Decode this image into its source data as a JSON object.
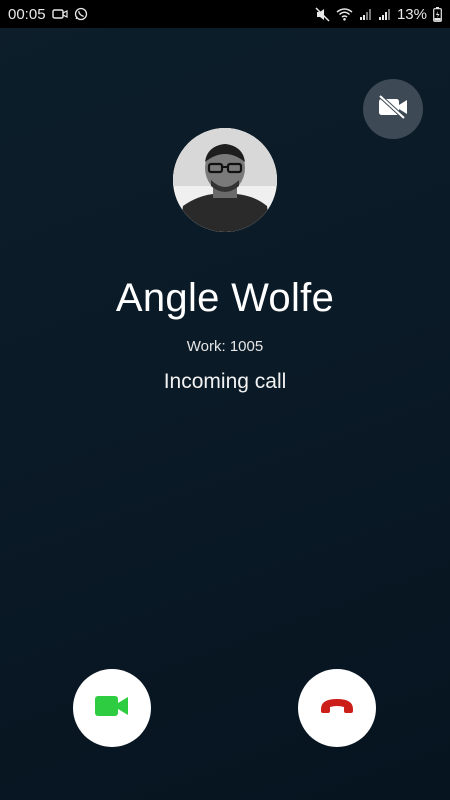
{
  "status_bar": {
    "time": "00:05",
    "battery_percent": "13%",
    "left_icons": [
      "video-camera-icon",
      "whatsapp-icon"
    ],
    "right_icons": [
      "mute-icon",
      "wifi-icon",
      "signal-icon",
      "signal-icon",
      "battery-charging-icon"
    ]
  },
  "call": {
    "caller_name": "Angle Wolfe",
    "caller_number": "Work: 1005",
    "status": "Incoming call"
  },
  "controls": {
    "video_toggle_icon": "video-off-icon",
    "accept_icon": "video-camera-icon",
    "decline_icon": "hang-up-icon"
  },
  "colors": {
    "background": "#0a1a26",
    "accept": "#2ecc40",
    "decline": "#cc1f1a",
    "video_toggle_bg": "#3d4a55"
  }
}
